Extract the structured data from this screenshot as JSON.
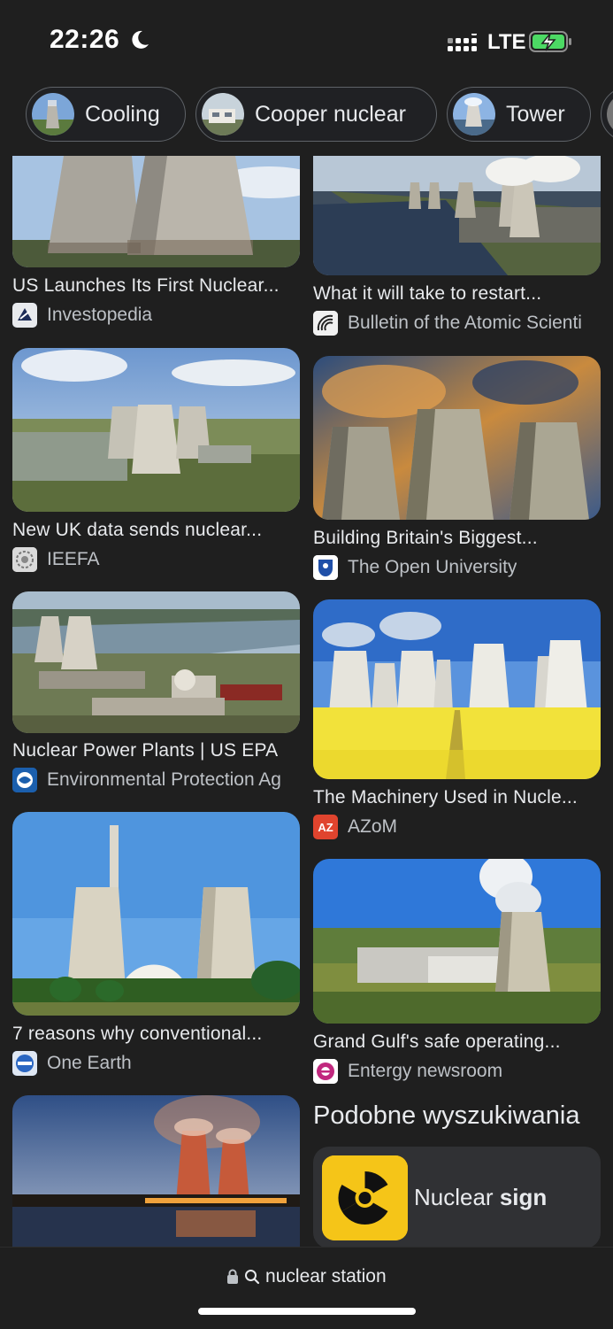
{
  "status_bar": {
    "time": "22:26",
    "network": "LTE"
  },
  "chips": [
    {
      "label": "Cooling"
    },
    {
      "label": "Cooper nuclear"
    },
    {
      "label": "Tower"
    }
  ],
  "results": [
    {
      "title": "US Launches Its First Nuclear...",
      "source": "Investopedia"
    },
    {
      "title": "What it will take to restart...",
      "source": "Bulletin of the Atomic Scienti"
    },
    {
      "title": "New UK data sends nuclear...",
      "source": "IEEFA"
    },
    {
      "title": "Building Britain's Biggest...",
      "source": "The Open University"
    },
    {
      "title": "Nuclear Power Plants | US EPA",
      "source": "Environmental Protection Ag"
    },
    {
      "title": "The Machinery Used in Nucle...",
      "source": "AZoM",
      "favicon_text": "AZ"
    },
    {
      "title": "7 reasons why conventional...",
      "source": "One Earth"
    },
    {
      "title": "Grand Gulf's safe operating...",
      "source": "Entergy newsroom"
    }
  ],
  "related": {
    "heading": "Podobne wyszukiwania",
    "items": [
      {
        "label_plain": "Nuclear",
        "label_bold": "sign"
      }
    ]
  },
  "address_bar": {
    "query": "nuclear station"
  }
}
